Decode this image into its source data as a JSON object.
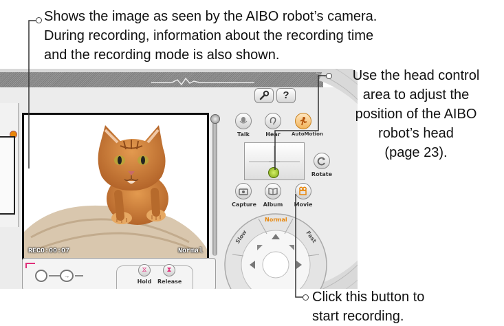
{
  "callouts": {
    "camera": [
      "Shows the image as seen by the AIBO robot’s camera.",
      "During recording, information about the recording time",
      "and the recording mode is also shown."
    ],
    "head": [
      "Use the head control",
      "area to adjust the",
      "position of the AIBO",
      "robot’s head",
      "(page 23)."
    ],
    "record": [
      "Click this button to",
      "start recording."
    ]
  },
  "viewer": {
    "rec_time": "REC0:00:07",
    "mode": "Normal"
  },
  "controls": {
    "talk": "Talk",
    "hear": "Hear",
    "automotion": "AutoMotion",
    "rotate": "Rotate",
    "capture": "Capture",
    "album": "Album",
    "movie": "Movie",
    "hold": "Hold",
    "release": "Release"
  },
  "dial": {
    "normal": "Normal",
    "slow": "Slow",
    "fast": "Fast"
  },
  "toolbar": {
    "help": "?"
  },
  "colors": {
    "accent_orange": "#e8860a",
    "accent_pink": "#e0307a",
    "frame_black": "#111111"
  }
}
